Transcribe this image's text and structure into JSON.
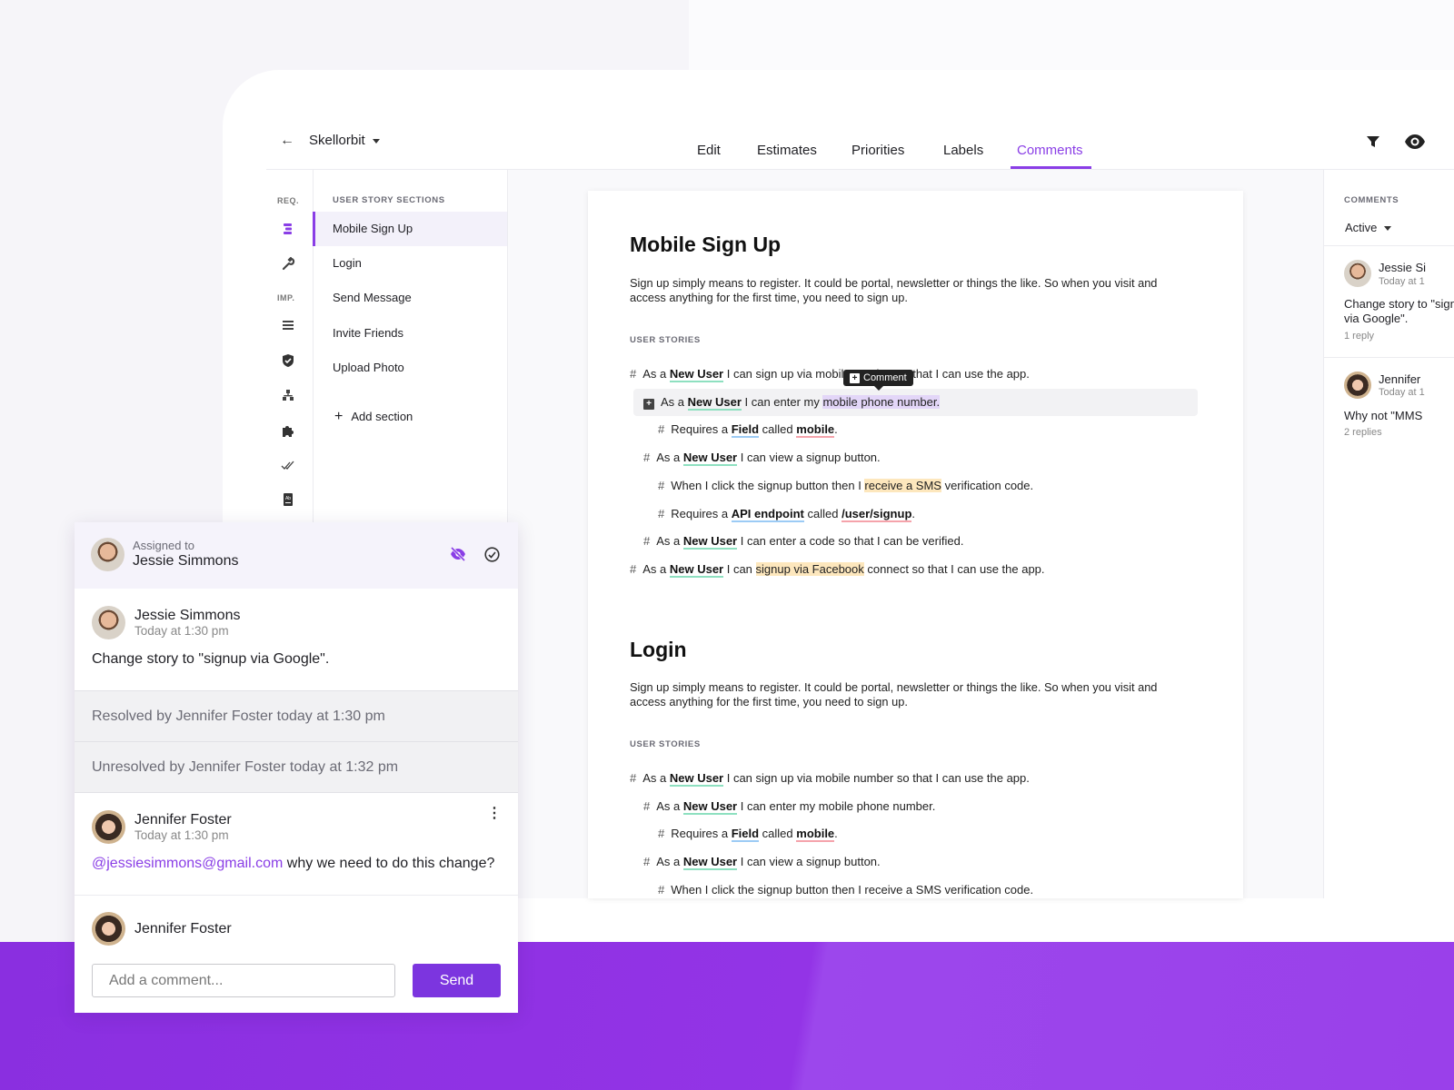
{
  "colors": {
    "accent": "#8a3ee6",
    "band": "#8a2fe0",
    "entity_underline": "#8ee0c0",
    "field_underline": "#9ccbf5",
    "value_underline": "#f5a3ab",
    "highlight_purple": "#e3d6f8",
    "highlight_yellow": "#fde7bd"
  },
  "header": {
    "back_icon": "arrow-left-icon",
    "project": "Skellorbit",
    "tabs": [
      "Edit",
      "Estimates",
      "Priorities",
      "Labels",
      "Comments"
    ],
    "active_tab": "Comments",
    "icons": [
      "filter-icon",
      "eye-icon"
    ]
  },
  "rail": {
    "req_label": "REQ.",
    "imp_label": "IMP.",
    "icons": [
      "stack-icon",
      "wrench-icon",
      "list-icon",
      "shield-check-icon",
      "hierarchy-icon",
      "puzzle-icon",
      "double-check-icon",
      "dictionary-icon"
    ]
  },
  "sections": {
    "heading": "USER STORY SECTIONS",
    "items": [
      "Mobile Sign Up",
      "Login",
      "Send Message",
      "Invite Friends",
      "Upload Photo"
    ],
    "active": "Mobile Sign Up",
    "add_label": "Add section"
  },
  "document": {
    "tooltip": "Comment",
    "sections": [
      {
        "title": "Mobile Sign Up",
        "para": "Sign up simply means to register. It could be portal, newsletter or things the like. So when you visit and access anything for the first time, you need to sign up.",
        "sub": "USER STORIES",
        "stories": [
          {
            "level": 0,
            "segs": [
              [
                "As a ",
                ""
              ],
              [
                "New User",
                "ent"
              ],
              [
                " I can sign up via mobile number so that I can use the app.",
                ""
              ]
            ]
          },
          {
            "level": 1,
            "selected": true,
            "segs": [
              [
                "As a ",
                ""
              ],
              [
                "New User",
                "ent"
              ],
              [
                " I can enter my ",
                ""
              ],
              [
                "mobile phone number.",
                "hlp"
              ]
            ]
          },
          {
            "level": 2,
            "segs": [
              [
                "Requires a ",
                ""
              ],
              [
                "Field",
                "fld"
              ],
              [
                " called ",
                ""
              ],
              [
                "mobile",
                "val"
              ],
              [
                ".",
                ""
              ]
            ]
          },
          {
            "level": 1,
            "segs": [
              [
                "As a ",
                ""
              ],
              [
                "New User",
                "ent"
              ],
              [
                " I can view a signup button.",
                ""
              ]
            ]
          },
          {
            "level": 2,
            "segs": [
              [
                "When I click the signup button then I ",
                ""
              ],
              [
                "receive a SMS",
                "hly"
              ],
              [
                " verification code.",
                ""
              ]
            ]
          },
          {
            "level": 2,
            "segs": [
              [
                "Requires a ",
                ""
              ],
              [
                "API endpoint",
                "fld"
              ],
              [
                " called ",
                ""
              ],
              [
                "/user/signup",
                "val"
              ],
              [
                ".",
                ""
              ]
            ]
          },
          {
            "level": 1,
            "segs": [
              [
                "As a ",
                ""
              ],
              [
                "New User",
                "ent"
              ],
              [
                " I can enter a code so that I can be verified.",
                ""
              ]
            ]
          },
          {
            "level": 0,
            "segs": [
              [
                "As a ",
                ""
              ],
              [
                "New User",
                "ent"
              ],
              [
                " I can ",
                ""
              ],
              [
                "signup via Facebook",
                "hly"
              ],
              [
                " connect so that I can use the app.",
                ""
              ]
            ]
          }
        ]
      },
      {
        "title": "Login",
        "para": "Sign up simply means to register. It could be portal, newsletter or things the like. So when you visit and access anything for the first time, you need to sign up.",
        "sub": "USER STORIES",
        "stories": [
          {
            "level": 0,
            "segs": [
              [
                "As a ",
                ""
              ],
              [
                "New User",
                "ent"
              ],
              [
                " I can sign up via mobile number so that I can use the app.",
                ""
              ]
            ]
          },
          {
            "level": 1,
            "segs": [
              [
                "As a ",
                ""
              ],
              [
                "New User",
                "ent"
              ],
              [
                " I can enter my mobile phone number.",
                ""
              ]
            ]
          },
          {
            "level": 2,
            "segs": [
              [
                "Requires a ",
                ""
              ],
              [
                "Field",
                "fld"
              ],
              [
                " called ",
                ""
              ],
              [
                "mobile",
                "val"
              ],
              [
                ".",
                ""
              ]
            ]
          },
          {
            "level": 1,
            "segs": [
              [
                "As a ",
                ""
              ],
              [
                "New User",
                "ent"
              ],
              [
                " I can view a signup button.",
                ""
              ]
            ]
          },
          {
            "level": 2,
            "segs": [
              [
                "When I click the signup button then I receive a SMS verification code.",
                ""
              ]
            ]
          }
        ]
      }
    ]
  },
  "comments_panel": {
    "heading": "COMMENTS",
    "filter": "Active",
    "items": [
      {
        "name": "Jessie Si",
        "time": "Today at 1",
        "text": "Change story to \"signup via Google\".",
        "replies": "1 reply"
      },
      {
        "name": "Jennifer",
        "time": "Today at 1",
        "text": "Why not \"MMS",
        "replies": "2 replies"
      }
    ]
  },
  "thread": {
    "assigned_label": "Assigned to",
    "assignee": "Jessie Simmons",
    "c1": {
      "name": "Jessie Simmons",
      "time": "Today at 1:30 pm",
      "text": "Change story to \"signup via Google\"."
    },
    "resolved": "Resolved by Jennifer Foster today at 1:30 pm",
    "unresolved": "Unresolved by Jennifer Foster today at 1:32 pm",
    "c2": {
      "name": "Jennifer Foster",
      "time": "Today at 1:30 pm",
      "mention": "@jessiesimmons@gmail.com",
      "text": " why we need to do this change?"
    },
    "composer": {
      "name": "Jennifer Foster",
      "placeholder": "Add a comment...",
      "send": "Send"
    }
  }
}
